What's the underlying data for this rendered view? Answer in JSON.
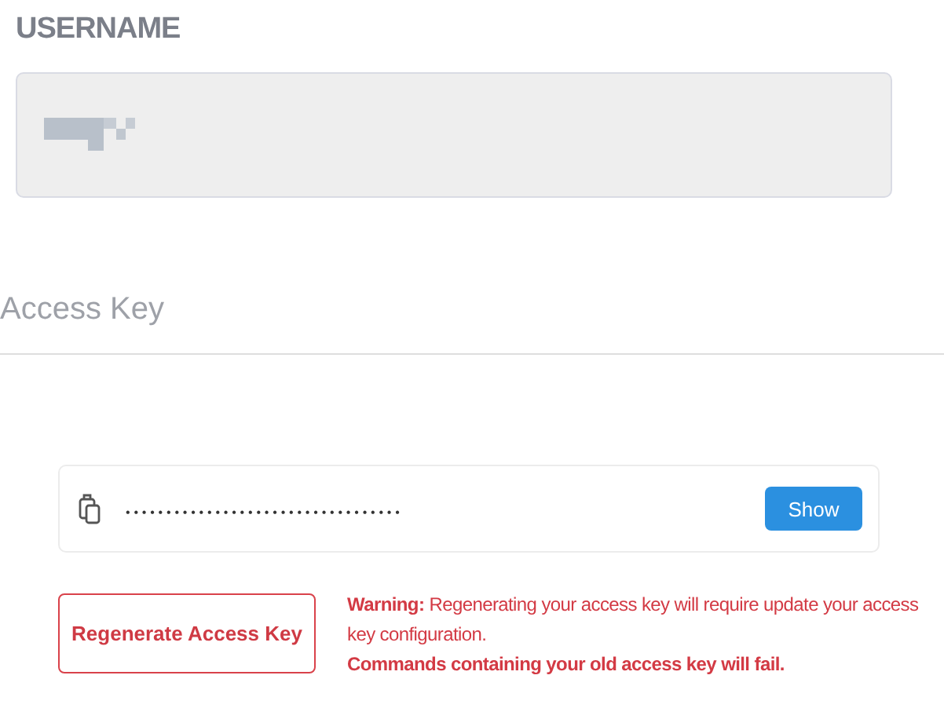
{
  "username": {
    "label": "USERNAME",
    "value_redacted": true
  },
  "access_key": {
    "heading": "Access Key",
    "masked_value": "••••••••••••••••••••••••••••••••••",
    "show_button": "Show"
  },
  "regenerate_button": "Regenerate Access Key",
  "warning": {
    "lead": "Warning:",
    "text": "Regenerating your access key will require update your access key configuration.",
    "consequence": "Commands containing your old access key will fail."
  }
}
